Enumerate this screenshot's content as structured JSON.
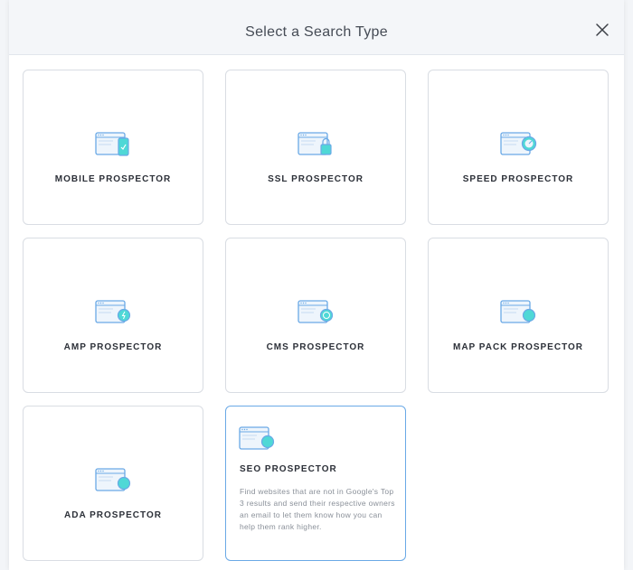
{
  "modal": {
    "title": "Select a Search Type",
    "close_icon": "close-icon"
  },
  "colors": {
    "accent_cyan": "#4fd8d6",
    "icon_blue": "#6aa9e6",
    "selected_border": "#6aa9e6"
  },
  "cards": [
    {
      "label": "MOBILE PROSPECTOR",
      "icon": "mobile-browser-icon"
    },
    {
      "label": "SSL PROSPECTOR",
      "icon": "lock-browser-icon"
    },
    {
      "label": "SPEED PROSPECTOR",
      "icon": "speed-browser-icon"
    },
    {
      "label": "AMP PROSPECTOR",
      "icon": "amp-browser-icon"
    },
    {
      "label": "CMS PROSPECTOR",
      "icon": "cms-browser-icon"
    },
    {
      "label": "MAP PACK PROSPECTOR",
      "icon": "map-browser-icon"
    },
    {
      "label": "ADA PROSPECTOR",
      "icon": "ada-browser-icon"
    },
    {
      "label": "SEO PROSPECTOR",
      "icon": "seo-browser-icon",
      "selected": true,
      "description": "Find websites that are not in Google's Top 3 results and send their respective owners an email to let them know how you can help them rank higher."
    }
  ]
}
